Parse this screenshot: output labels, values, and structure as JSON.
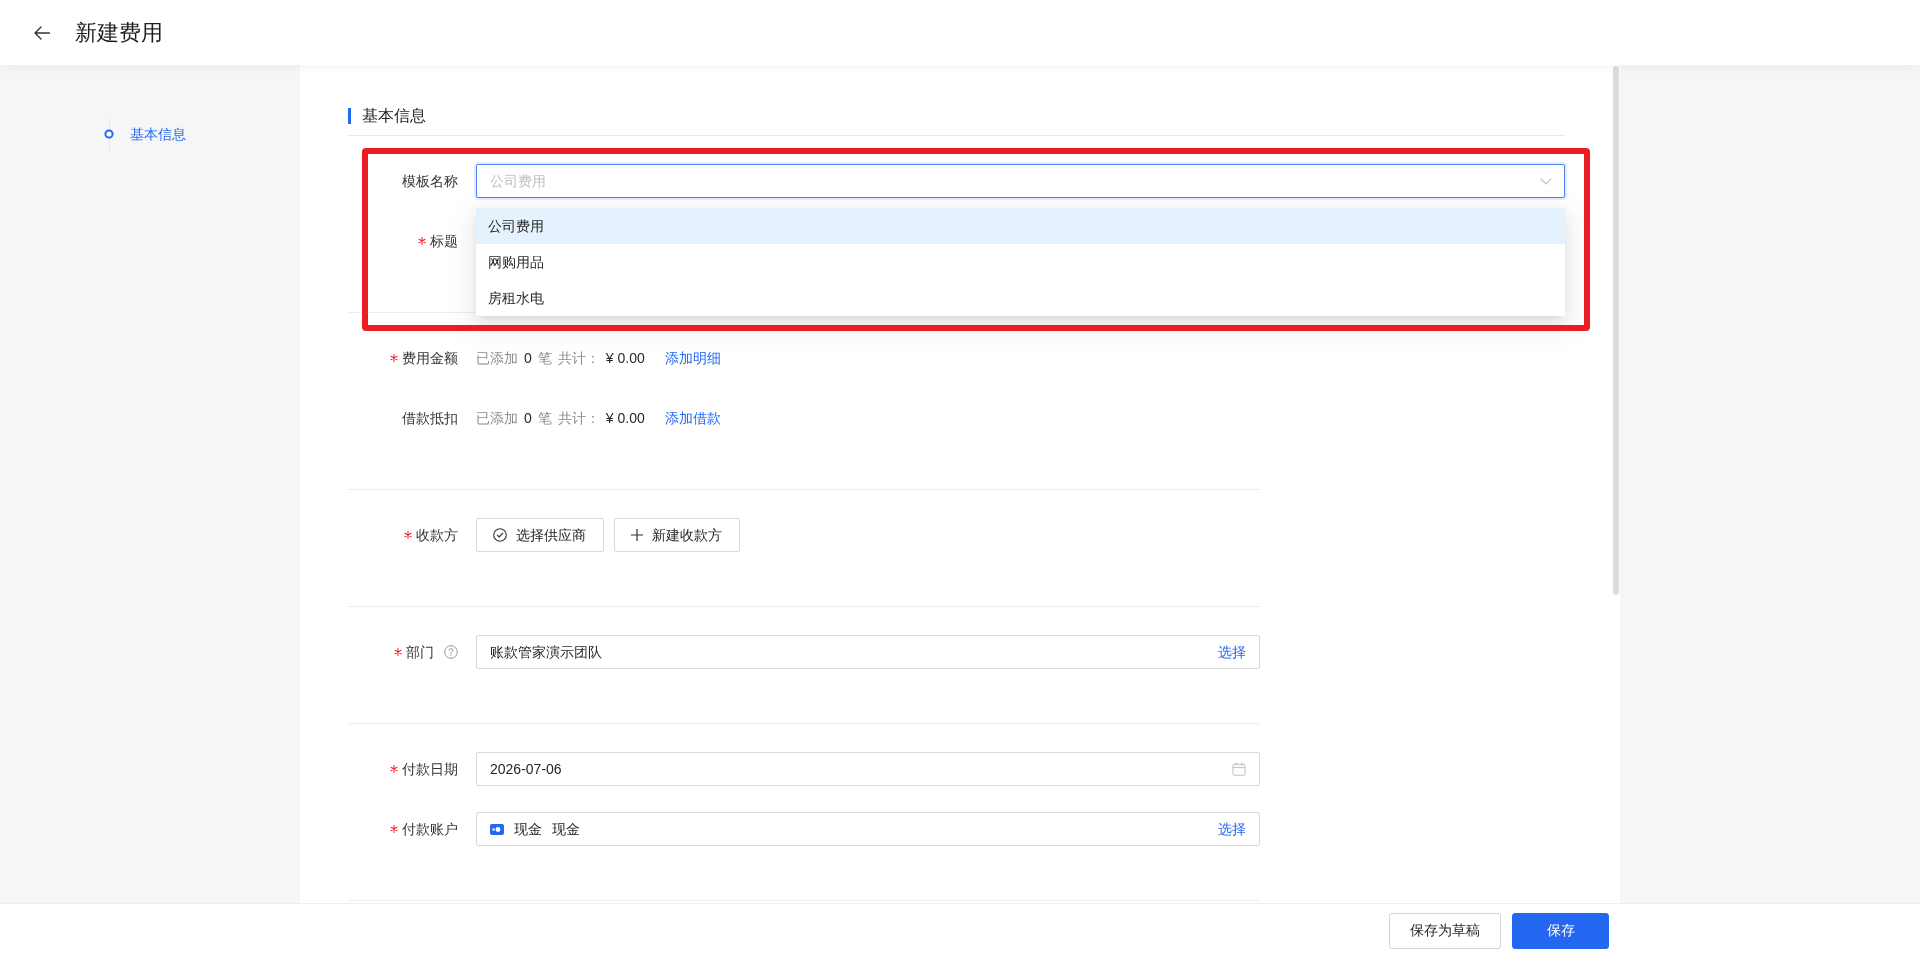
{
  "header": {
    "title": "新建费用"
  },
  "sidebar": {
    "items": [
      {
        "label": "基本信息",
        "selected": true
      }
    ]
  },
  "section": {
    "title": "基本信息"
  },
  "groups": [
    {
      "highlighted": true,
      "rows": [
        {
          "kind": "select",
          "label": "模板名称",
          "required": false,
          "value": "公司费用",
          "open": true,
          "options": [
            {
              "label": "公司费用",
              "selected": true
            },
            {
              "label": "网购用品",
              "selected": false
            },
            {
              "label": "房租水电",
              "selected": false
            }
          ]
        },
        {
          "kind": "text",
          "label": "标题",
          "required": true
        }
      ]
    },
    {
      "highlighted": false,
      "rows": [
        {
          "kind": "summary",
          "label": "费用金额",
          "required": true,
          "added_label": "已添加",
          "count": "0",
          "count_unit": "笔",
          "total_label": "共计：",
          "total": "¥ 0.00",
          "action": "添加明细"
        },
        {
          "kind": "summary",
          "label": "借款抵扣",
          "required": false,
          "added_label": "已添加",
          "count": "0",
          "count_unit": "笔",
          "total_label": "共计：",
          "total": "¥ 0.00",
          "action": "添加借款"
        }
      ]
    },
    {
      "highlighted": false,
      "rows": [
        {
          "kind": "buttons",
          "label": "收款方",
          "required": true,
          "buttons": [
            {
              "kind": "pick",
              "label": "选择供应商"
            },
            {
              "kind": "add",
              "label": "新建收款方"
            }
          ]
        }
      ]
    },
    {
      "highlighted": false,
      "rows": [
        {
          "kind": "picker",
          "label": "部门",
          "required": true,
          "help": true,
          "value": "账款管家演示团队",
          "action": "选择"
        }
      ]
    },
    {
      "highlighted": false,
      "rows": [
        {
          "kind": "date",
          "label": "付款日期",
          "required": true,
          "value": "2026-07-06"
        },
        {
          "kind": "account",
          "label": "付款账户",
          "required": true,
          "value": "现金",
          "detail": "现金",
          "action": "选择"
        }
      ]
    }
  ],
  "footer": {
    "buttons": [
      {
        "label": "保存为草稿",
        "primary": false
      },
      {
        "label": "保存",
        "primary": true
      }
    ]
  }
}
